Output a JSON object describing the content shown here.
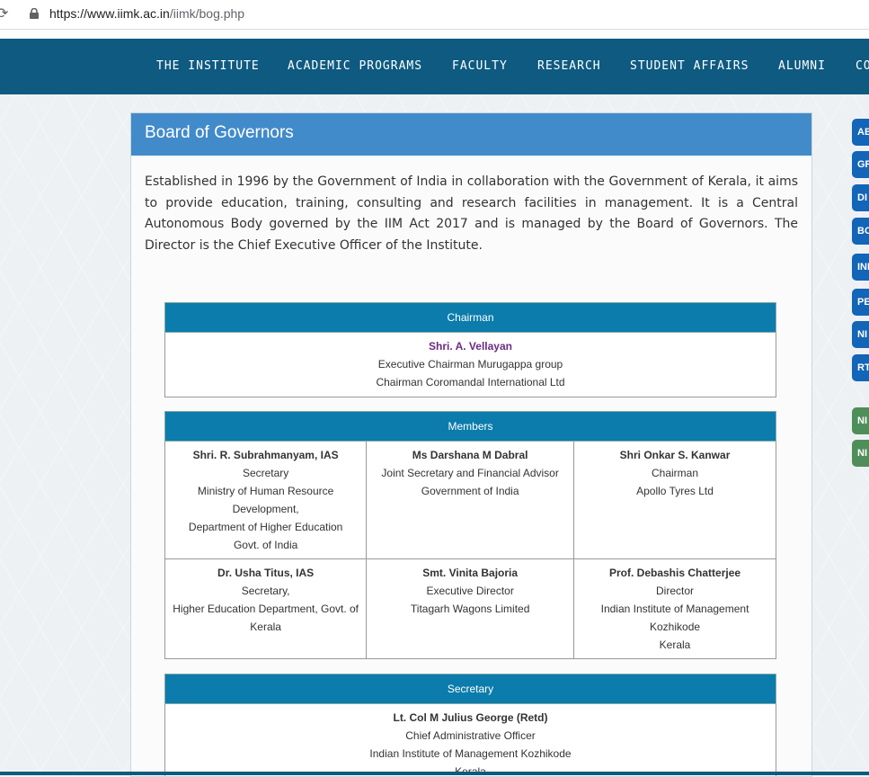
{
  "browser": {
    "url_host": "https://www.iimk.ac.in",
    "url_path": "/iimk/bog.php"
  },
  "nav": [
    "THE INSTITUTE",
    "ACADEMIC PROGRAMS",
    "FACULTY",
    "RESEARCH",
    "STUDENT AFFAIRS",
    "ALUMNI",
    "CO"
  ],
  "page": {
    "title": "Board of Governors",
    "intro": "Established in 1996 by the Government of India in collaboration with the Government of Kerala, it aims to provide education, training, consulting and research facilities in management. It is a Central Autonomous Body governed by the IIM Act 2017 and is managed by the Board of Governors. The Director is the Chief Executive Officer of the Institute."
  },
  "chairman": {
    "heading": "Chairman",
    "name": "Shri. A. Vellayan",
    "line1": "Executive Chairman Murugappa group",
    "line2": "Chairman Coromandal International Ltd"
  },
  "members": {
    "heading": "Members",
    "rows": [
      [
        {
          "name": "Shri. R. Subrahmanyam, IAS",
          "lines": [
            "Secretary",
            "Ministry of Human Resource",
            "Development,",
            "Department of Higher Education",
            "Govt. of India"
          ]
        },
        {
          "name": "Ms Darshana M Dabral",
          "lines": [
            "Joint Secretary and Financial Advisor",
            "Government of India"
          ]
        },
        {
          "name": "Shri Onkar S. Kanwar",
          "lines": [
            "Chairman",
            "Apollo Tyres Ltd"
          ]
        }
      ],
      [
        {
          "name": "Dr. Usha Titus, IAS",
          "lines": [
            "Secretary,",
            "Higher Education Department, Govt. of",
            "Kerala"
          ]
        },
        {
          "name": "Smt. Vinita Bajoria",
          "lines": [
            "Executive Director",
            "Titagarh Wagons Limited"
          ]
        },
        {
          "name": "Prof. Debashis Chatterjee",
          "lines": [
            "Director",
            "Indian Institute of Management",
            "Kozhikode",
            "Kerala"
          ]
        }
      ]
    ]
  },
  "secretary": {
    "heading": "Secretary",
    "name": "Lt. Col M Julius George (Retd)",
    "line1": "Chief Administrative Officer",
    "line2": "Indian Institute of Management Kozhikode",
    "line3": "Kerala"
  },
  "sidetabs": [
    "AB",
    "GR",
    "DI",
    "BO",
    "INI",
    "PE",
    "NI",
    "RT",
    "NI",
    "NI"
  ]
}
